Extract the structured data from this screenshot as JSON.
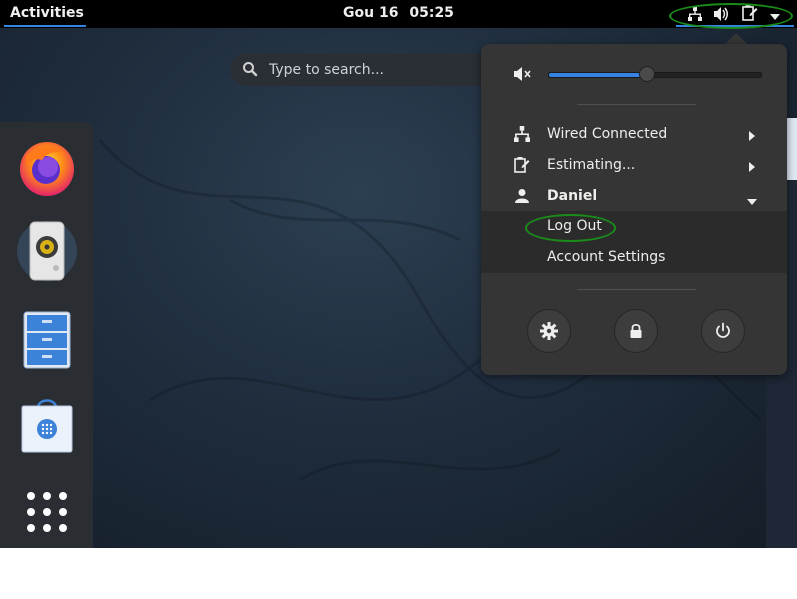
{
  "topbar": {
    "activities_label": "Activities",
    "date": "Gou 16",
    "time": "05:25",
    "tray_icons": [
      "network-wired-icon",
      "volume-icon",
      "battery-icon",
      "dropdown-arrow-icon"
    ]
  },
  "search": {
    "placeholder": "Type to search..."
  },
  "dash": {
    "items": [
      "firefox-icon",
      "rhythmbox-icon",
      "files-icon",
      "software-icon",
      "show-apps-icon"
    ]
  },
  "system_menu": {
    "volume": {
      "icon": "volume-muted-icon",
      "level_fraction": 0.46
    },
    "items": [
      {
        "icon": "network-wired-icon",
        "label": "Wired Connected"
      },
      {
        "icon": "battery-estimating-icon",
        "label": "Estimating..."
      },
      {
        "icon": "user-icon",
        "label": "Daniel"
      }
    ],
    "user_submenu": [
      {
        "label": "Log Out"
      },
      {
        "label": "Account Settings"
      }
    ],
    "buttons": [
      "settings-icon",
      "lock-icon",
      "power-icon"
    ]
  },
  "colors": {
    "accent": "#3584e4",
    "menu_bg": "#353535",
    "highlight_ellipse": "#1a8c1a"
  }
}
